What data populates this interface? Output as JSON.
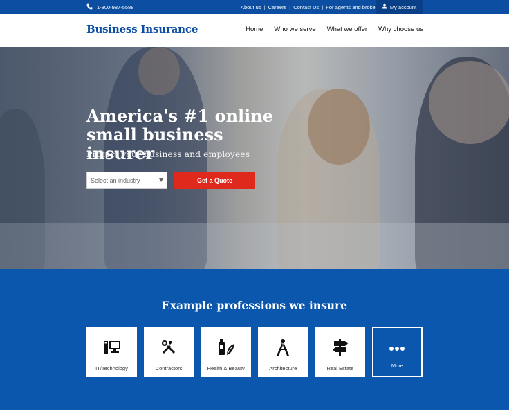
{
  "topbar": {
    "phone": "1-800-987-5588",
    "links": [
      "About us",
      "Careers",
      "Contact Us",
      "For agents and brokers"
    ],
    "account": "My account"
  },
  "header": {
    "brand": "Business Insurance",
    "nav": [
      "Home",
      "Who we serve",
      "What we offer",
      "Why choose us"
    ]
  },
  "hero": {
    "headline_line1": "America's #1 online",
    "headline_line2": "small business insurer",
    "subheadline": "Protect your business and employees",
    "industry_select": "Select an industry",
    "cta": "Get a Quote"
  },
  "professions": {
    "title": "Example professions we insure",
    "items": [
      {
        "label": "IT/Technology",
        "icon": "computer-icon"
      },
      {
        "label": "Contractors",
        "icon": "tools-icon"
      },
      {
        "label": "Health & Beauty",
        "icon": "health-beauty-icon"
      },
      {
        "label": "Architecture",
        "icon": "compass-icon"
      },
      {
        "label": "Real Estate",
        "icon": "signpost-icon"
      },
      {
        "label": "More",
        "icon": "more-icon"
      }
    ]
  },
  "colors": {
    "brand_blue": "#0b4ea2",
    "section_blue": "#0b57ad",
    "cta_red": "#e0291d"
  }
}
